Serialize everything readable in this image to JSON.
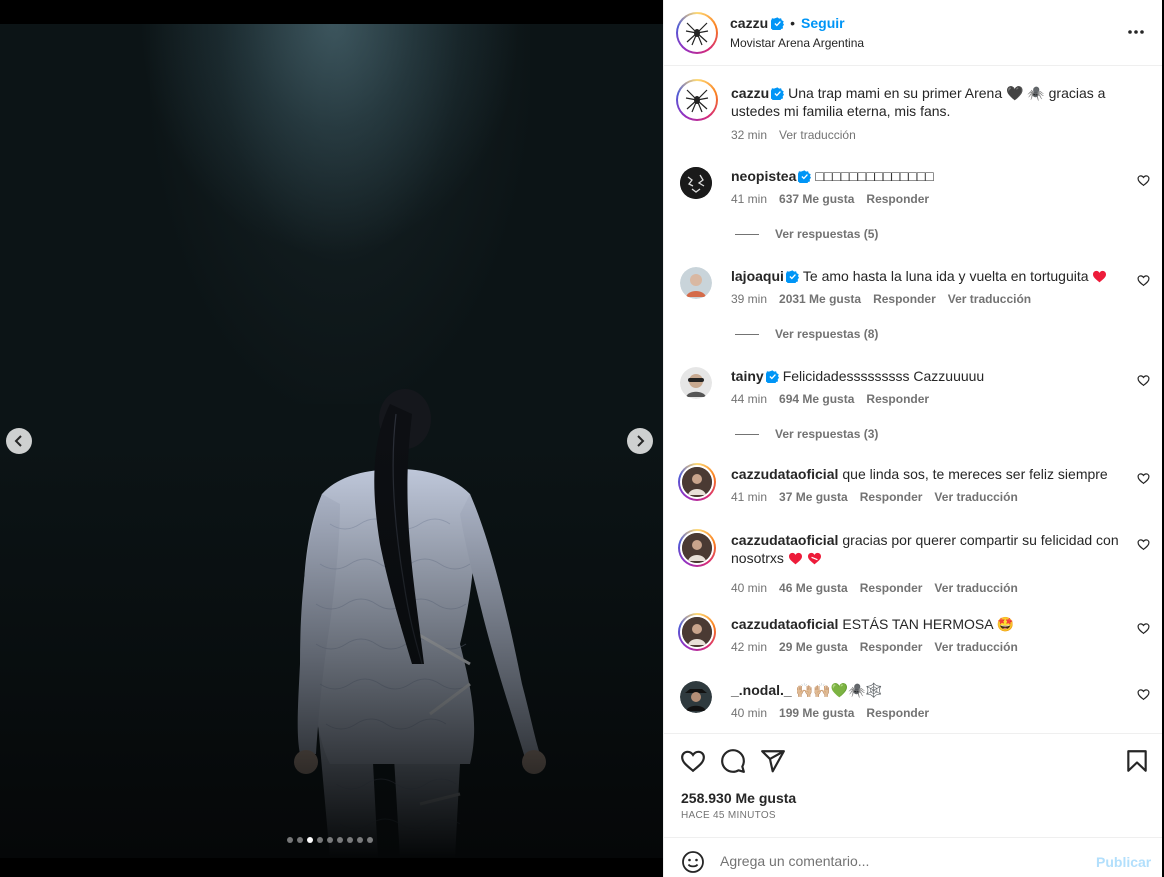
{
  "post": {
    "username": "cazzu",
    "follow_label": "Seguir",
    "separator": "•",
    "location": "Movistar Arena Argentina",
    "caption": {
      "username": "cazzu",
      "text": "Una trap mami en su primer Arena 🖤 🕷️ gracias a ustedes mi familia eterna, mis fans.",
      "time": "32 min",
      "translate": "Ver traducción"
    },
    "media": {
      "slide_count": 9,
      "active_slide": 3
    }
  },
  "comments": [
    {
      "username": "neopistea",
      "verified": true,
      "text": "□□□□□□□□□□□□□□",
      "time": "41 min",
      "likes": "637 Me gusta",
      "reply": "Responder",
      "translate": "",
      "replies": "Ver respuestas (5)"
    },
    {
      "username": "lajoaqui",
      "verified": true,
      "text": "Te amo hasta la luna ida y vuelta en tortuguita",
      "time": "39 min",
      "likes": "2031 Me gusta",
      "reply": "Responder",
      "translate": "Ver traducción",
      "replies": "Ver respuestas (8)"
    },
    {
      "username": "tainy",
      "verified": true,
      "text": "Felicidadesssssssss Cazzuuuuu",
      "time": "44 min",
      "likes": "694 Me gusta",
      "reply": "Responder",
      "translate": "",
      "replies": "Ver respuestas (3)"
    },
    {
      "username": "cazzudataoficial",
      "verified": false,
      "text": "que linda sos, te mereces ser feliz siempre",
      "time": "41 min",
      "likes": "37 Me gusta",
      "reply": "Responder",
      "translate": "Ver traducción",
      "replies": ""
    },
    {
      "username": "cazzudataoficial",
      "verified": false,
      "text": "gracias por querer compartir su felicidad con nosotrxs",
      "time": "40 min",
      "likes": "46 Me gusta",
      "reply": "Responder",
      "translate": "Ver traducción",
      "replies": ""
    },
    {
      "username": "cazzudataoficial",
      "verified": false,
      "text": "ESTÁS TAN HERMOSA 🤩",
      "time": "42 min",
      "likes": "29 Me gusta",
      "reply": "Responder",
      "translate": "Ver traducción",
      "replies": ""
    },
    {
      "username": "_.nodal._",
      "verified": false,
      "text": "🙌🏼🙌🏼💚🕷️🕸️",
      "time": "40 min",
      "likes": "199 Me gusta",
      "reply": "Responder",
      "translate": "",
      "replies": ""
    }
  ],
  "footer": {
    "likes": "258.930 Me gusta",
    "time_ago": "HACE 45 MINUTOS",
    "comment_placeholder": "Agrega un comentario...",
    "publish_label": "Publicar"
  },
  "colors": {
    "accent": "#0095f6",
    "publish_disabled": "#b2dffc",
    "heart_red": "#ed1c3a",
    "meta_gray": "#737373"
  },
  "icons": [
    "more-icon",
    "verified-icon",
    "heart-icon",
    "comment-icon",
    "share-icon",
    "bookmark-icon",
    "smiley-icon",
    "chevron-left-icon",
    "chevron-right-icon"
  ]
}
